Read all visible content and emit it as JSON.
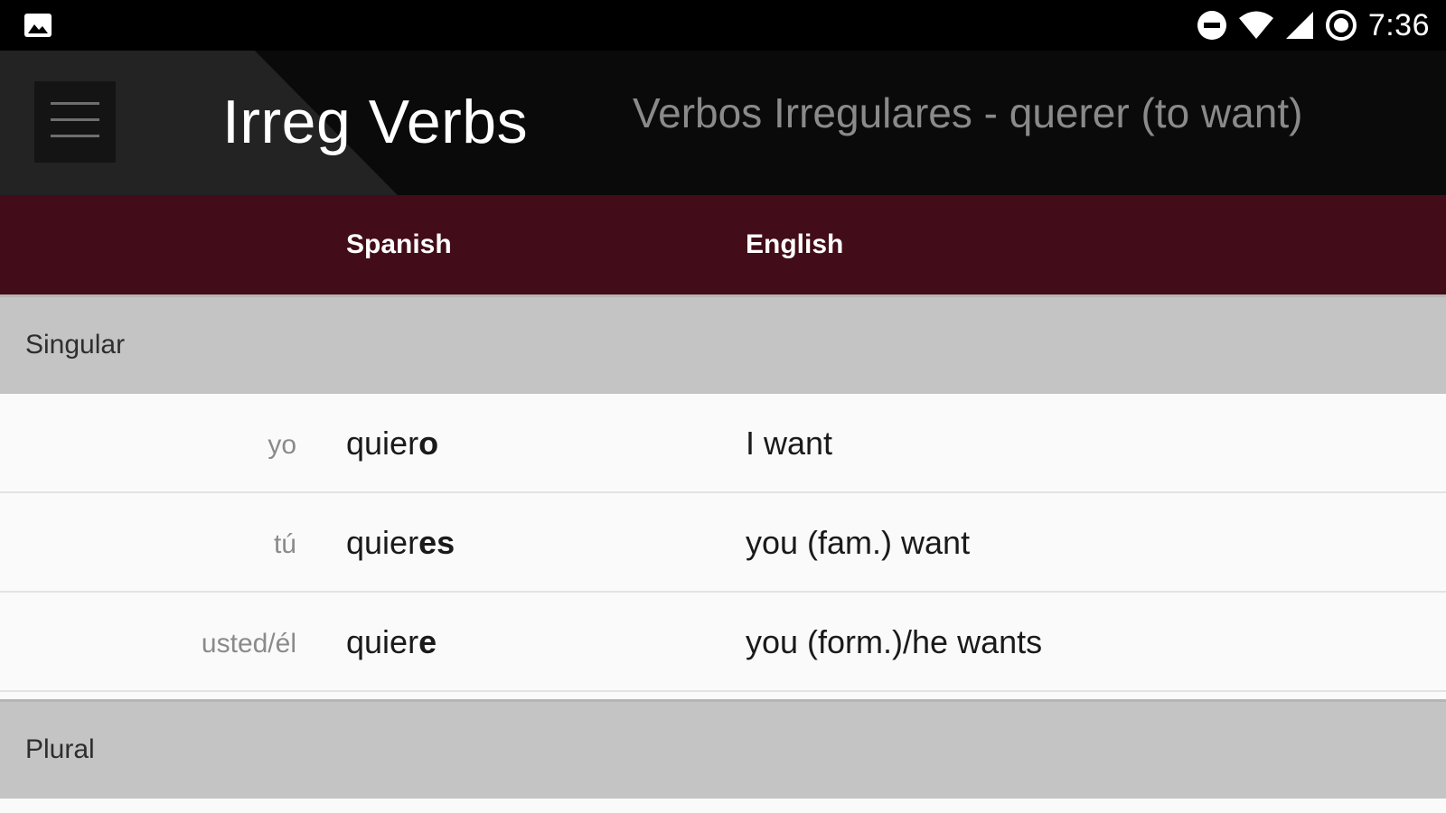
{
  "status_bar": {
    "time": "7:36",
    "left_icon": "image-notification-icon",
    "right_icons": [
      "do-not-disturb-icon",
      "wifi-icon",
      "cell-signal-icon",
      "data-saver-icon"
    ]
  },
  "app_bar": {
    "title": "Irreg Verbs",
    "subtitle": "Verbos Irregulares - querer (to want)",
    "menu_icon": "hamburger-menu-icon"
  },
  "table": {
    "columns": [
      "Spanish",
      "English"
    ],
    "sections": [
      {
        "label": "Singular",
        "rows": [
          {
            "pronoun": "yo",
            "stem": "quier",
            "ending": "o",
            "english": "I want"
          },
          {
            "pronoun": "tú",
            "stem": "quier",
            "ending": "es",
            "english": "you (fam.) want"
          },
          {
            "pronoun": "usted/él",
            "stem": "quier",
            "ending": "e",
            "english": "you (form.)/he wants"
          }
        ]
      },
      {
        "label": "Plural",
        "rows": []
      }
    ]
  },
  "colors": {
    "status_bar": "#000000",
    "app_bar": "#0d0d0d",
    "table_header": "#420c18",
    "section_bg": "#c4c4c4",
    "row_bg": "#fafafa"
  }
}
